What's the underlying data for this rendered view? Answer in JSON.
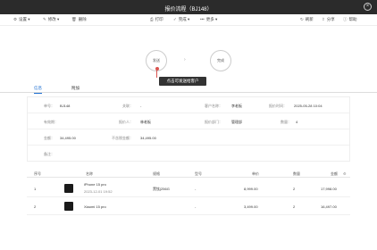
{
  "window": {
    "title": "报价流程（BJ148）"
  },
  "toolbar": {
    "left": [
      {
        "icon": "⚙",
        "label": "设置",
        "has_dropdown": true
      },
      {
        "icon": "✎",
        "label": "修改",
        "has_dropdown": true
      },
      {
        "icon": "🗑",
        "label": "删除"
      }
    ],
    "center": [
      {
        "icon": "⎙",
        "label": "打印"
      },
      {
        "icon": "✓",
        "label": "完成",
        "has_dropdown": true
      },
      {
        "icon": "•••",
        "label": "更多",
        "has_dropdown": true
      }
    ],
    "right": [
      {
        "icon": "↻",
        "label": "刷新"
      },
      {
        "icon": "⇪",
        "label": "分享"
      },
      {
        "icon": "ⓘ",
        "label": "帮助"
      }
    ]
  },
  "flow": {
    "nodes": [
      "发送",
      "完成"
    ],
    "arrow": "›",
    "tooltip": "点击可发送给客户"
  },
  "tabs": [
    {
      "label": "信息",
      "active": true
    },
    {
      "label": "附加",
      "active": false
    }
  ],
  "info": {
    "row1": [
      {
        "label": "单号：",
        "value": "BJ148"
      },
      {
        "label": "关联：",
        "value": "-"
      },
      {
        "label": "客户名称：",
        "value": "李老板"
      },
      {
        "label": "报价时间：",
        "value": "2025-05-28 10:04"
      }
    ],
    "row2": [
      {
        "label": "有效期：",
        "value": ""
      },
      {
        "label": "报价人：",
        "value": "林老板"
      },
      {
        "label": "报价部门：",
        "value": "管理部"
      },
      {
        "label": "数量：",
        "value": "4"
      }
    ],
    "row3": [
      {
        "label": "金额：",
        "value": "34,495.00"
      },
      {
        "label": "不含税金额：",
        "value": "34,495.00"
      }
    ],
    "row4": [
      {
        "label": "备注：",
        "value": ""
      }
    ]
  },
  "table": {
    "headers": [
      "序号",
      "名称",
      "规格",
      "型号",
      "单价",
      "数量",
      "金额"
    ],
    "rows": [
      {
        "no": "1",
        "name": "iPhone 15 pro",
        "sub": "2023-12-01 19:52",
        "spec": "黑钛|256G",
        "model": "-",
        "price": "8,999.00",
        "qty": "2",
        "amount": "17,998.00"
      },
      {
        "no": "2",
        "name": "Xiaomi 15 pro",
        "sub": "",
        "spec": "",
        "model": "-",
        "price": "3,499.00",
        "qty": "2",
        "amount": "16,497.00"
      }
    ]
  }
}
